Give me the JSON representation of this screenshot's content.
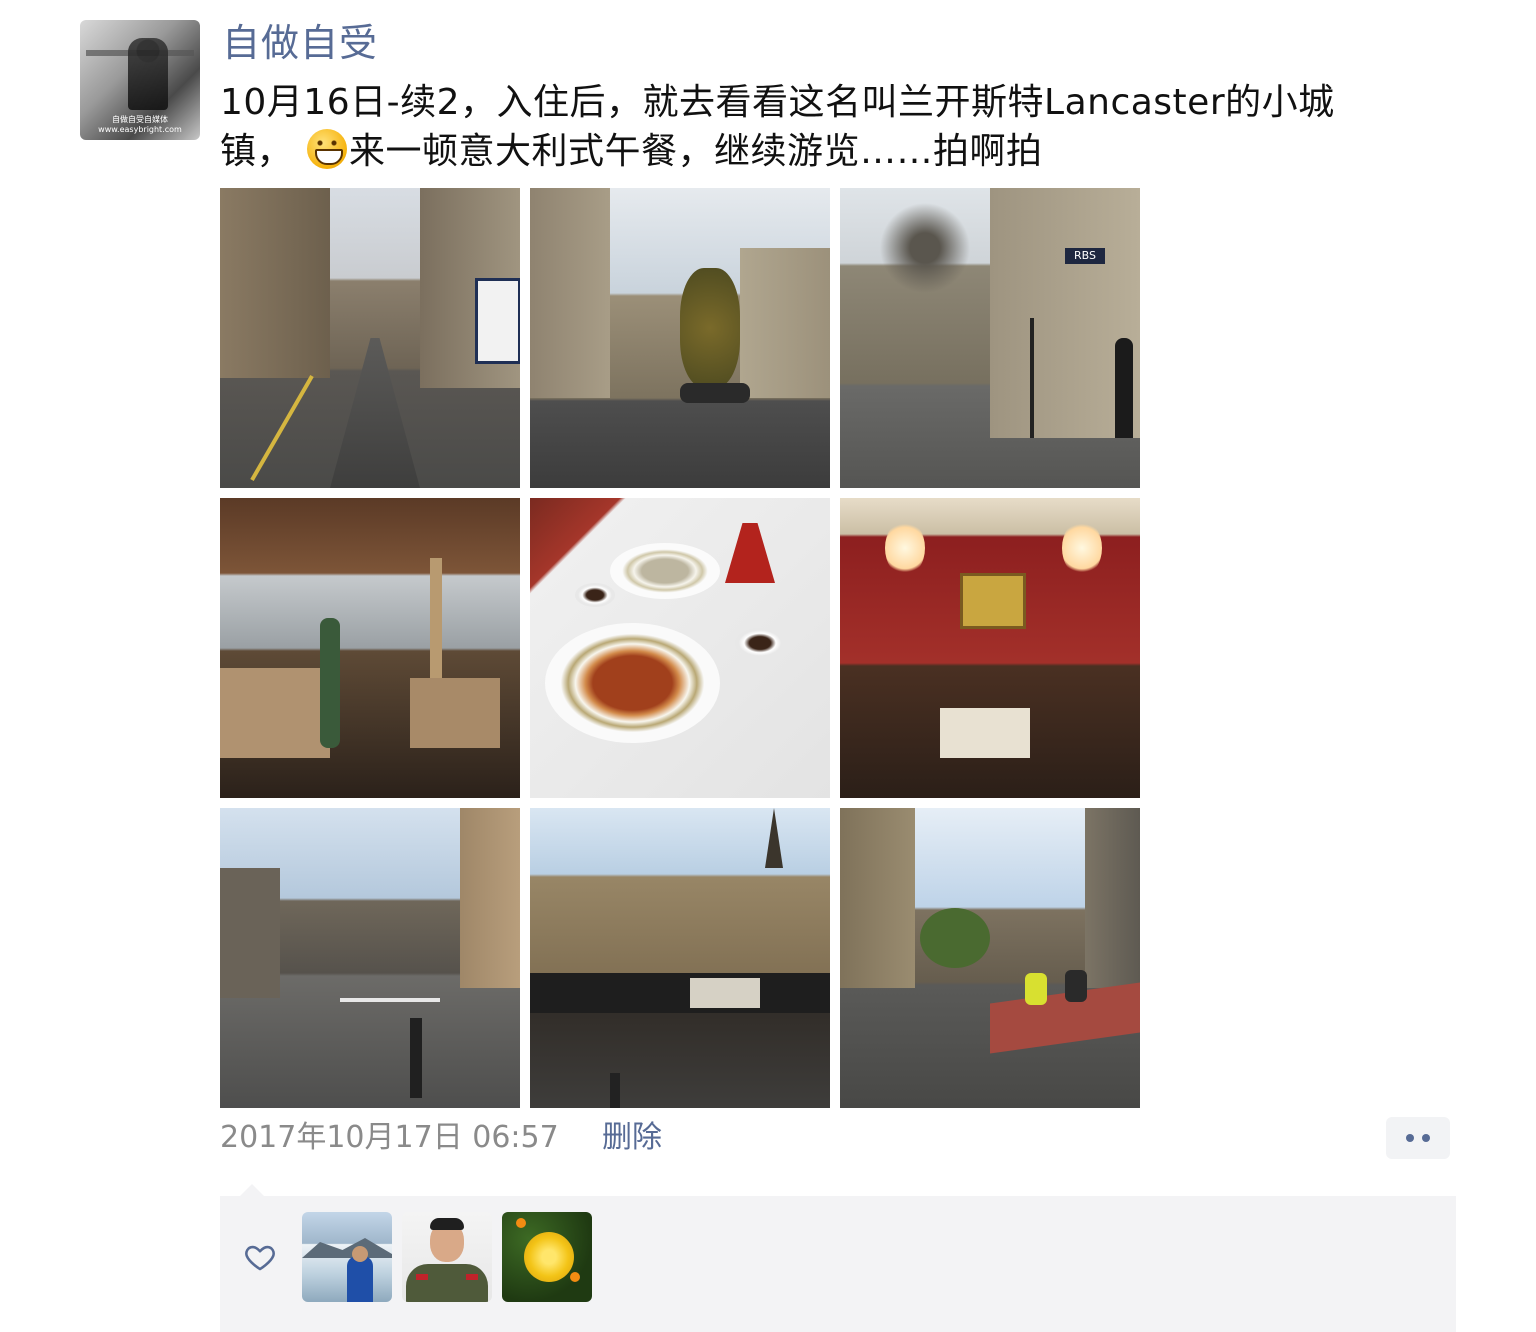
{
  "post": {
    "username": "自做自受",
    "avatar_caption": "自做自受自媒体 www.easybright.com",
    "text_line1": "10月16日-续2，入住后，就去看看这名叫兰开斯特Lancaster的小城",
    "text_line2_before_emoji": "镇，",
    "text_line2_after_emoji": "来一顿意大利式午餐，继续游览……拍啊拍",
    "emoji": "grinning-face",
    "photos": [
      {
        "name": "narrow-street"
      },
      {
        "name": "sloped-street"
      },
      {
        "name": "rbs-street"
      },
      {
        "name": "restaurant-interior"
      },
      {
        "name": "pasta-meal"
      },
      {
        "name": "red-dining-room"
      },
      {
        "name": "crossing-street"
      },
      {
        "name": "stone-buildings"
      },
      {
        "name": "cyclists-street"
      }
    ],
    "timestamp": "2017年10月17日 06:57",
    "delete_label": "删除",
    "more_icon": "two-dots",
    "likers": [
      {
        "name": "liker-glacier"
      },
      {
        "name": "liker-uniform"
      },
      {
        "name": "liker-flower"
      }
    ]
  },
  "colors": {
    "link": "#576b95",
    "meta": "#8a8a8a",
    "panel": "#f3f3f5"
  }
}
